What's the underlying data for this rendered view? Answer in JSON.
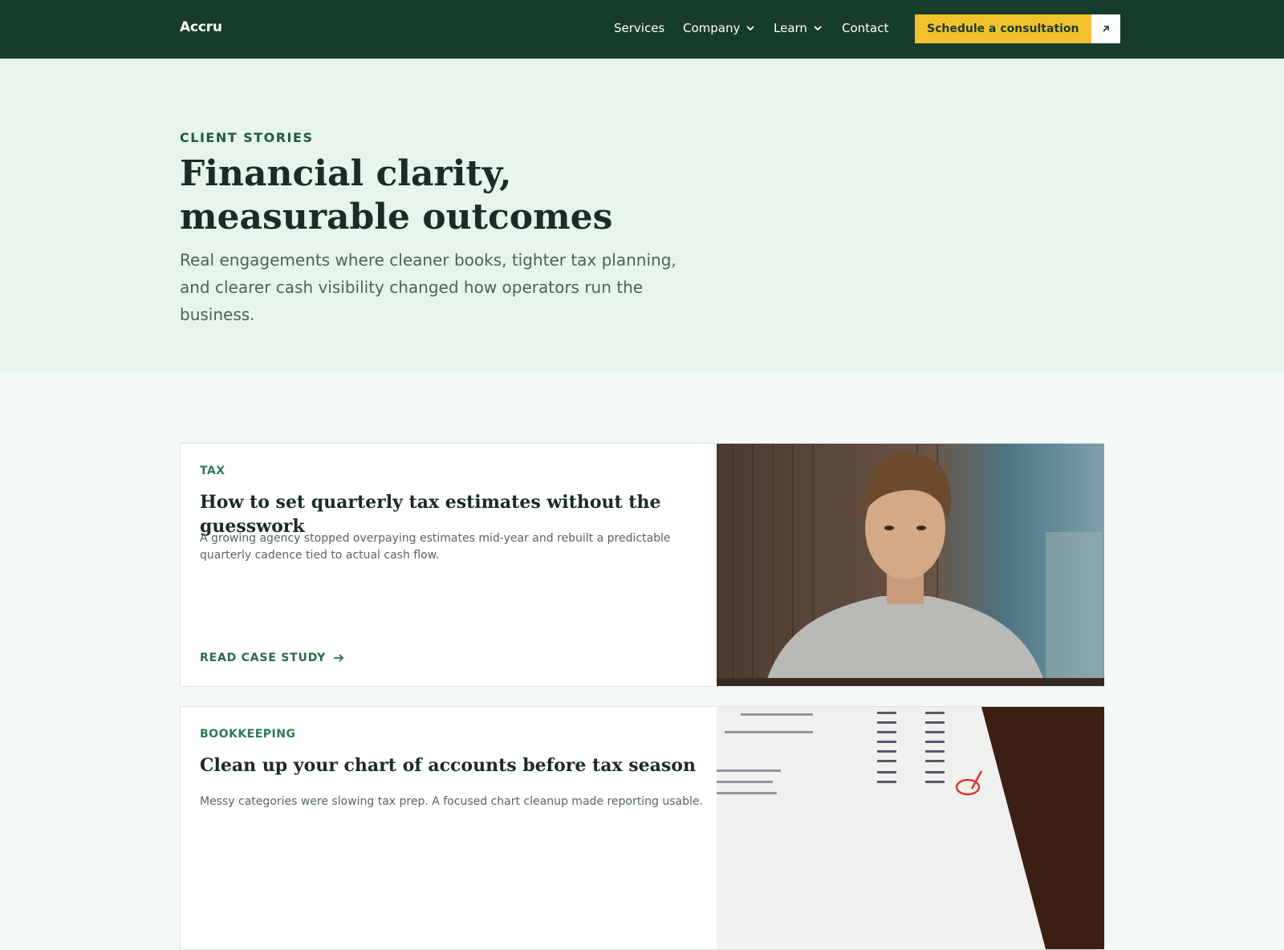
{
  "header": {
    "brand": "Accru",
    "nav": [
      {
        "label": "Services",
        "dropdown": false
      },
      {
        "label": "Company",
        "dropdown": true
      },
      {
        "label": "Learn",
        "dropdown": true
      },
      {
        "label": "Contact",
        "dropdown": false
      }
    ],
    "cta_label": "Schedule a consultation",
    "cta_icon": "arrow-up-right-icon"
  },
  "hero": {
    "eyebrow": "CLIENT STORIES",
    "headline": "Financial clarity, measurable outcomes",
    "subtitle": "Real engagements where cleaner books, tighter tax planning, and clearer cash visibility changed how operators run the business."
  },
  "cards": [
    {
      "tag": "TAX",
      "title": "How to set quarterly tax estimates without the guesswork",
      "text": "A growing agency stopped overpaying estimates mid-year and rebuilt a predictable quarterly cadence tied to actual cash flow.",
      "link": "READ CASE STUDY",
      "image": "man-at-table-photo"
    },
    {
      "tag": "BOOKKEEPING",
      "title": "Clean up your chart of accounts before tax season",
      "text": "Messy categories were slowing tax prep. A focused chart cleanup made reporting usable.",
      "image": "financial-statement-photo"
    }
  ],
  "colors": {
    "header_bg": "#183c2b",
    "hero_bg": "#e6f4ec",
    "accent_yellow": "#f2c12e",
    "accent_green": "#2f7a52"
  }
}
